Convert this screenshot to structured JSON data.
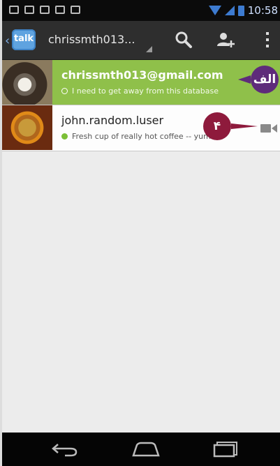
{
  "status_bar": {
    "time": "10:58",
    "colors": {
      "background": "#0b0b0b",
      "signal": "#3d7bd0"
    },
    "left_icons": [
      "gmail-icon",
      "talk-icon",
      "download-icon",
      "download-icon",
      "download-icon"
    ]
  },
  "action_bar": {
    "logo_text": "talk",
    "account_title": "chrissmth013...",
    "actions": [
      "search-icon",
      "add-friend-icon",
      "overflow-menu-icon"
    ]
  },
  "contacts": [
    {
      "name": "chrissmth013@gmail.com",
      "status": "I need to get away from this database",
      "presence": "invisible",
      "selected": true,
      "accent": "#8fc04a"
    },
    {
      "name": "john.random.luser",
      "status": "Fresh cup of really hot coffee -- yum!",
      "presence": "available",
      "selected": false,
      "capability": "video-icon"
    }
  ],
  "annotations": {
    "a_label": "الف",
    "b_label": "۴"
  },
  "nav_bar": {
    "buttons": [
      "back-icon",
      "home-icon",
      "recent-apps-icon"
    ]
  }
}
